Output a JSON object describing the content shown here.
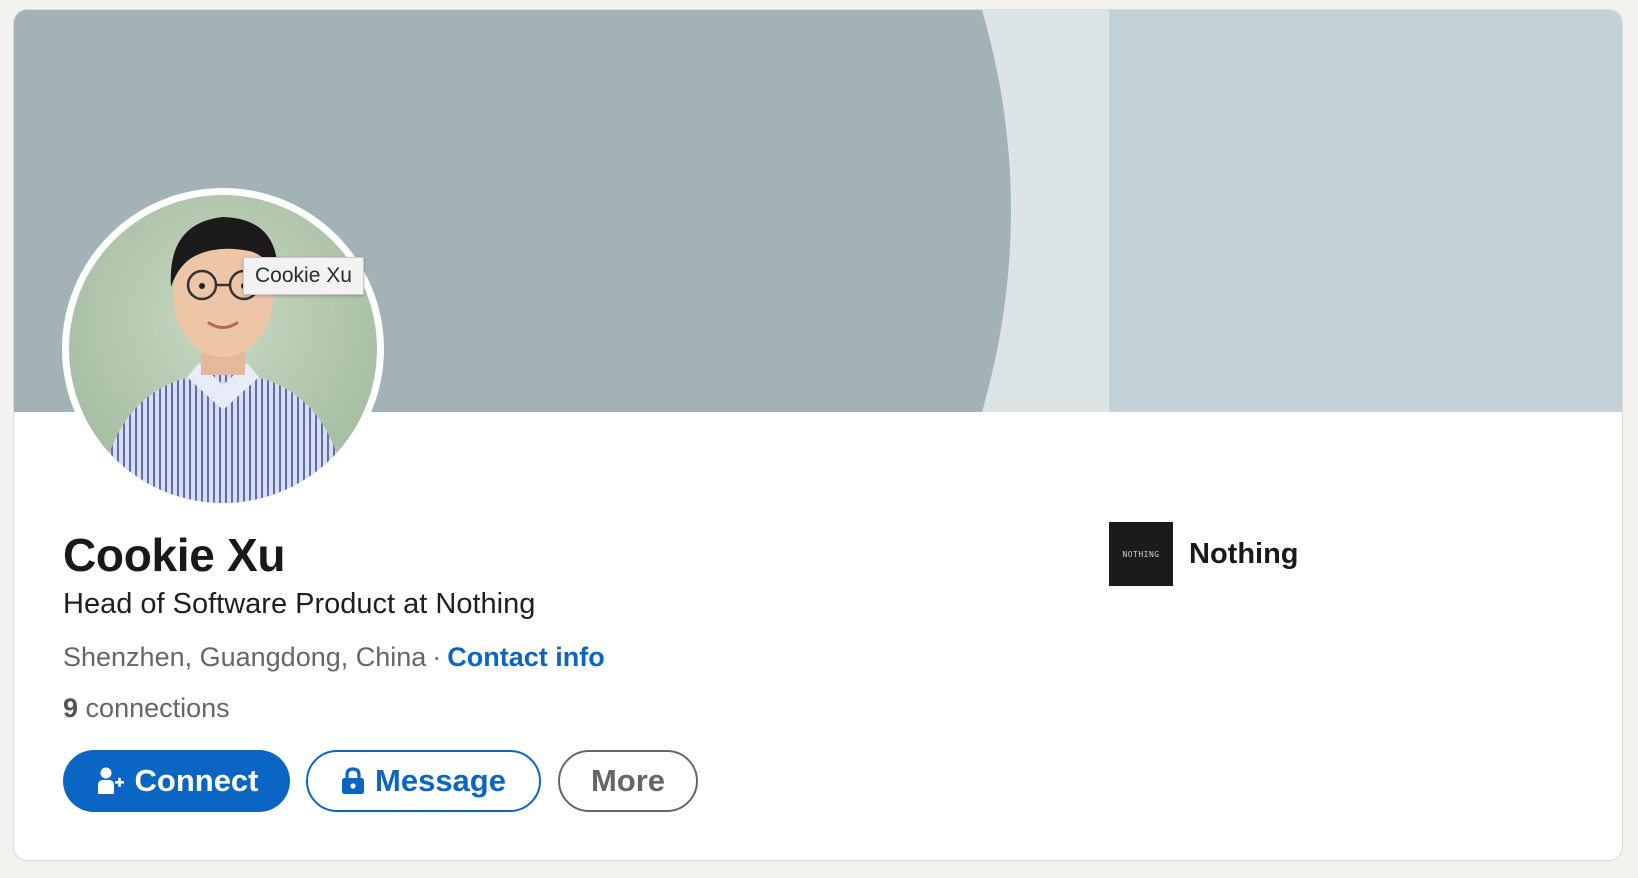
{
  "colors": {
    "page_bg": "#f4f2ee",
    "banner_left": "#a3b3b5",
    "banner_middle": "#dce4e6",
    "banner_right": "#c2d2d6",
    "link_blue": "#0a66c2",
    "text_secondary": "#666666"
  },
  "profile": {
    "avatar_tooltip": "Cookie Xu",
    "name": "Cookie Xu",
    "headline": "Head of Software Product at Nothing",
    "location": "Shenzhen, Guangdong, China",
    "separator": "·",
    "contact_info_label": "Contact info",
    "connections_count": "9",
    "connections_label": "connections"
  },
  "actions": {
    "connect_label": "Connect",
    "connect_icon": "add-person-icon",
    "message_label": "Message",
    "message_icon": "lock-icon",
    "more_label": "More"
  },
  "current_company": {
    "name": "Nothing",
    "logo_text": "NOTHING"
  }
}
